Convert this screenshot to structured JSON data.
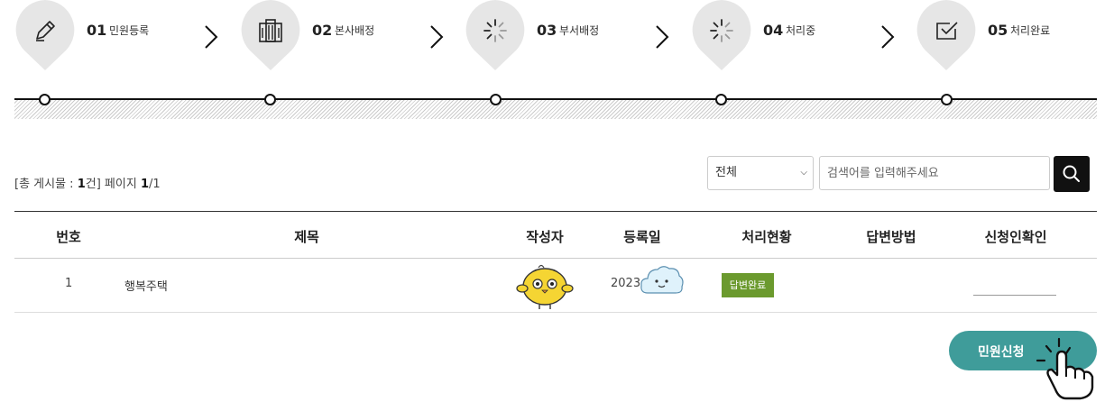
{
  "steps": [
    {
      "num": "01",
      "label": "민원등록",
      "icon": "pencil-icon"
    },
    {
      "num": "02",
      "label": "본사배정",
      "icon": "building-icon"
    },
    {
      "num": "03",
      "label": "부서배정",
      "icon": "loading-icon"
    },
    {
      "num": "04",
      "label": "처리중",
      "icon": "loading-icon"
    },
    {
      "num": "05",
      "label": "처리완료",
      "icon": "checkbox-icon"
    }
  ],
  "board": {
    "count_prefix": "[총 게시물 : ",
    "count_value": "1",
    "count_mid": "건] 페이지 ",
    "page_current": "1",
    "page_total": "/1"
  },
  "search": {
    "filter_selected": "전체",
    "placeholder": "검색어를 입력해주세요"
  },
  "table": {
    "headers": [
      "번호",
      "제목",
      "작성자",
      "등록일",
      "처리현황",
      "답변방법",
      "신청인확인"
    ],
    "rows": [
      {
        "no": "1",
        "title": "행복주택",
        "date": "2023",
        "status": "답변완료"
      }
    ]
  },
  "apply_button": {
    "label": "민원신청"
  },
  "colors": {
    "accent": "#3f9c9a",
    "status_done": "#6b9a2e",
    "step_bubble": "#e6e6e6"
  }
}
